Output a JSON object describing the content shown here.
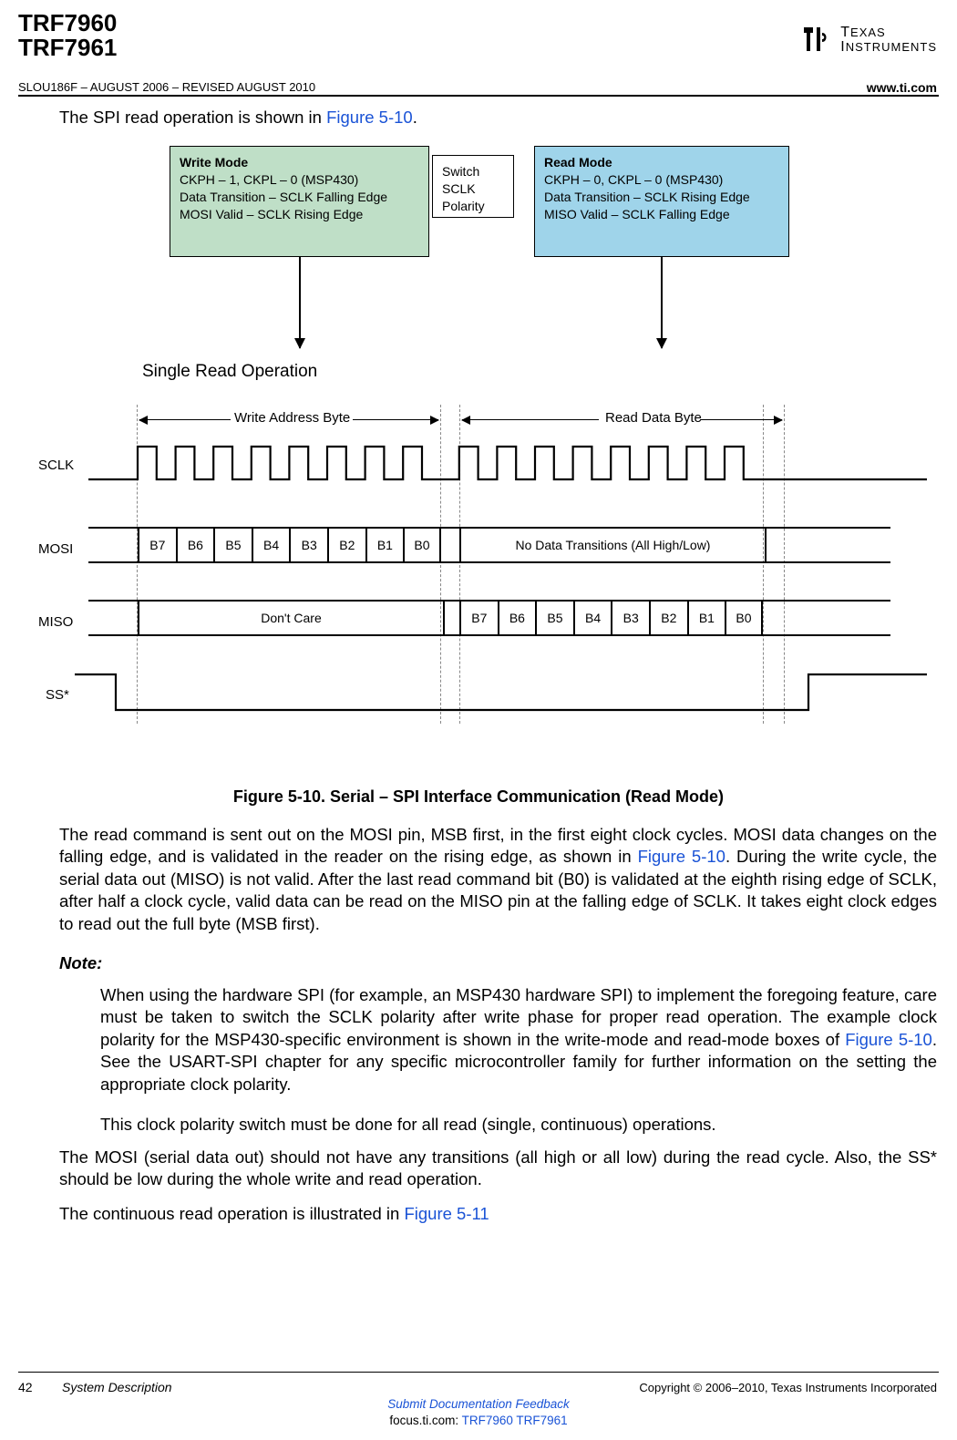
{
  "header": {
    "part1": "TRF7960",
    "part2": "TRF7961",
    "docnum": "SLOU186F – AUGUST 2006 – REVISED AUGUST 2010",
    "url": "www.ti.com",
    "logo_text": "TEXAS INSTRUMENTS"
  },
  "intro": {
    "pre": "The SPI read operation is shown in ",
    "link": "Figure 5-10",
    "post": "."
  },
  "modes": {
    "write": {
      "title": "Write Mode",
      "l1": "CKPH – 1, CKPL – 0 (MSP430)",
      "l2": "Data Transition – SCLK Falling Edge",
      "l3": "MOSI Valid – SCLK Rising Edge"
    },
    "switch": {
      "l1": "Switch",
      "l2": "SCLK",
      "l3": "Polarity"
    },
    "read": {
      "title": "Read Mode",
      "l1": "CKPH – 0, CKPL – 0 (MSP430)",
      "l2": "Data Transition – SCLK Rising Edge",
      "l3": "MISO Valid – SCLK Falling Edge"
    }
  },
  "timing": {
    "sro": "Single Read Operation",
    "write_label": "Write Address Byte",
    "read_label": "Read Data Byte",
    "sclk": "SCLK",
    "mosi": "MOSI",
    "miso": "MISO",
    "ss": "SS*",
    "bits": [
      "B7",
      "B6",
      "B5",
      "B4",
      "B3",
      "B2",
      "B1",
      "B0"
    ],
    "no_data": "No Data Transitions (All High/Low)",
    "dont_care": "Don't Care"
  },
  "caption": "Figure 5-10. Serial – SPI Interface Communication (Read Mode)",
  "p1": {
    "a": "The read command is sent out on the MOSI pin, MSB first, in the first eight clock cycles. MOSI data changes on the falling edge, and is validated in the reader on the rising edge, as shown in ",
    "link": "Figure 5-10",
    "b": ". During the write cycle, the serial data out (MISO) is not valid. After the last read command bit (B0) is validated at the eighth rising edge of SCLK, after half a clock cycle, valid data can be read on the MISO pin at the falling edge of SCLK. It takes eight clock edges to read out the full byte (MSB first)."
  },
  "note": {
    "title": "Note:",
    "body1a": "When using the hardware SPI (for example, an MSP430 hardware SPI) to implement the foregoing feature, care must be taken to switch the SCLK polarity after write phase for proper read operation. The example clock polarity for the MSP430-specific environment is shown in the write-mode and read-mode boxes of ",
    "link": "Figure 5-10",
    "body1b": ". See the USART-SPI chapter for any specific microcontroller family for further information on the setting the appropriate clock polarity.",
    "body2": "This clock polarity switch must be done for all read (single, continuous) operations."
  },
  "p2": "The MOSI (serial data out) should not have any transitions (all high or all low) during the read cycle. Also, the SS* should be low during the whole write and read operation.",
  "p3": {
    "a": "The continuous read operation is illustrated in ",
    "link": "Figure 5-11"
  },
  "footer": {
    "page": "42",
    "section": "System Description",
    "copy": "Copyright © 2006–2010, Texas Instruments Incorporated",
    "submit": "Submit Documentation Feedback",
    "focus_pre": "focus.ti.com: ",
    "focus_link": "TRF7960 TRF7961"
  }
}
